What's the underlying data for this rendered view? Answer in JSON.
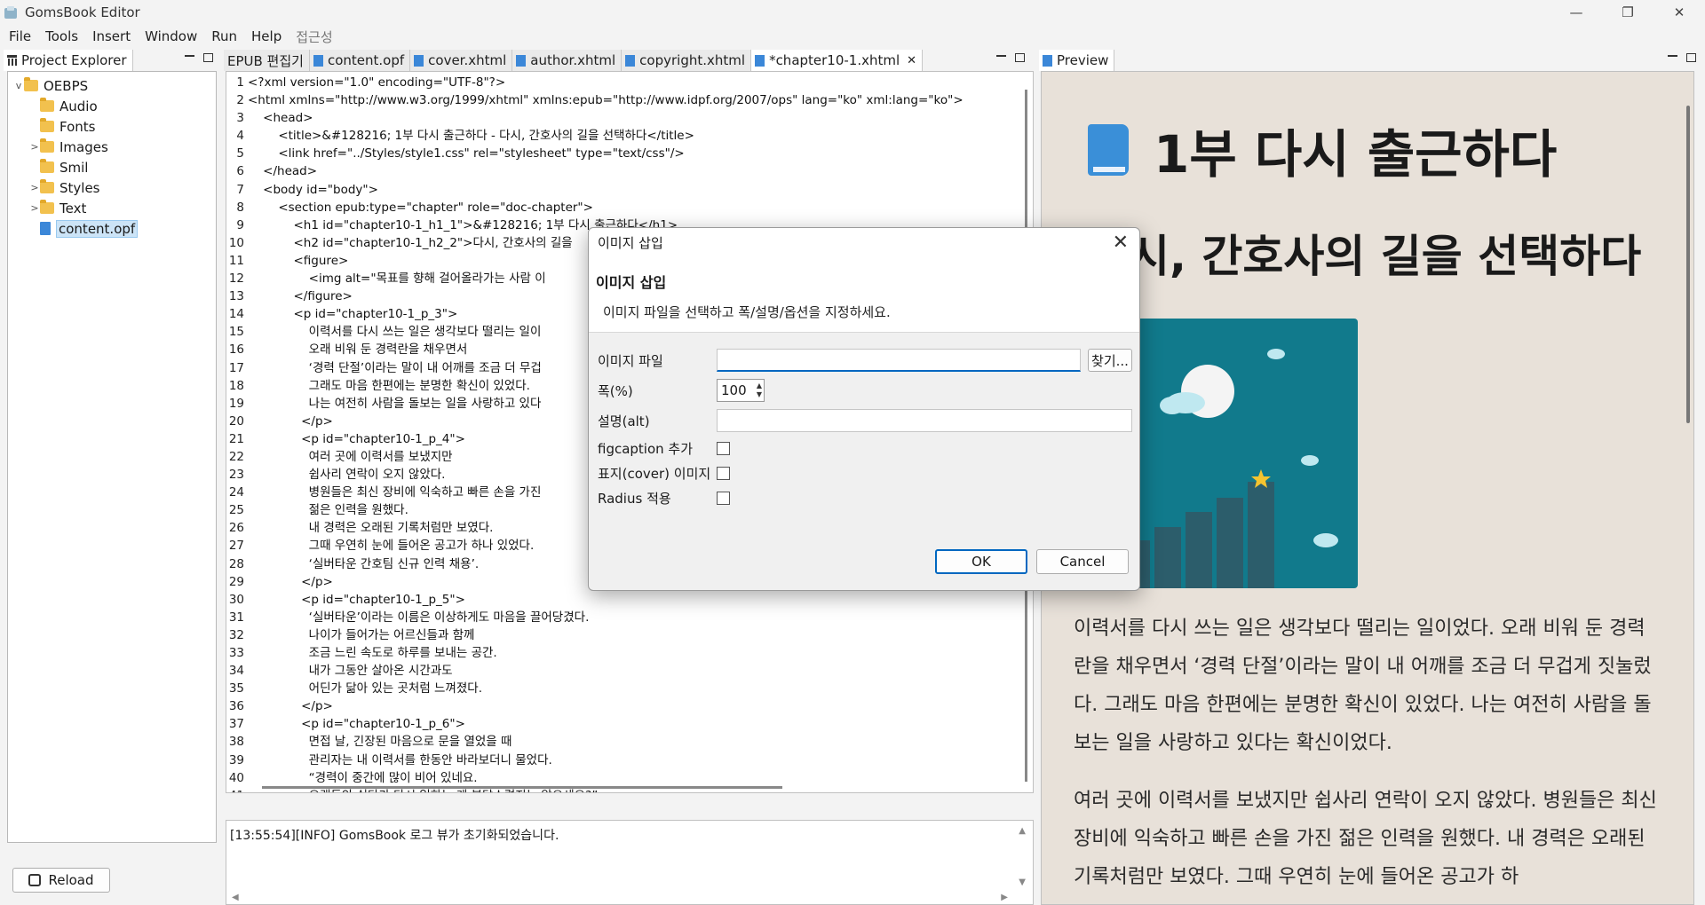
{
  "window": {
    "title": "GomsBook Editor",
    "controls": {
      "minimize": "—",
      "maximize": "❐",
      "close": "✕"
    }
  },
  "menu": [
    "File",
    "Tools",
    "Insert",
    "Window",
    "Run",
    "Help",
    "접근성"
  ],
  "project_explorer": {
    "tab_label": "Project Explorer",
    "tree": [
      {
        "label": "OEBPS",
        "type": "folder",
        "expander": "v",
        "depth": 0
      },
      {
        "label": "Audio",
        "type": "folder",
        "expander": "",
        "depth": 1
      },
      {
        "label": "Fonts",
        "type": "folder",
        "expander": "",
        "depth": 1
      },
      {
        "label": "Images",
        "type": "folder",
        "expander": ">",
        "depth": 1
      },
      {
        "label": "Smil",
        "type": "folder",
        "expander": "",
        "depth": 1
      },
      {
        "label": "Styles",
        "type": "folder",
        "expander": ">",
        "depth": 1
      },
      {
        "label": "Text",
        "type": "folder",
        "expander": ">",
        "depth": 1
      },
      {
        "label": "content.opf",
        "type": "file",
        "expander": "",
        "depth": 1,
        "selected": true
      }
    ],
    "reload_label": "Reload"
  },
  "editor": {
    "tabs": [
      {
        "label": "EPUB 편집기",
        "icon": false
      },
      {
        "label": "content.opf",
        "icon": true
      },
      {
        "label": "cover.xhtml",
        "icon": true
      },
      {
        "label": "author.xhtml",
        "icon": true
      },
      {
        "label": "copyright.xhtml",
        "icon": true
      },
      {
        "label": "*chapter10-1.xhtml",
        "icon": true,
        "active": true,
        "close": "✕"
      }
    ],
    "lines": [
      "<?xml version=\"1.0\" encoding=\"UTF-8\"?>",
      "<html xmlns=\"http://www.w3.org/1999/xhtml\" xmlns:epub=\"http://www.idpf.org/2007/ops\" lang=\"ko\" xml:lang=\"ko\">",
      "    <head>",
      "        <title>&#128216; 1부 다시 출근하다 - 다시, 간호사의 길을 선택하다</title>",
      "        <link href=\"../Styles/style1.css\" rel=\"stylesheet\" type=\"text/css\"/>",
      "    </head>",
      "    <body id=\"body\">",
      "        <section epub:type=\"chapter\" role=\"doc-chapter\">",
      "            <h1 id=\"chapter10-1_h1_1\">&#128216; 1부 다시 출근하다</h1>",
      "            <h2 id=\"chapter10-1_h2_2\">다시, 간호사의 길을",
      "            <figure>",
      "                <img alt=\"목표를 향해 걸어올라가는 사람 이",
      "            </figure>",
      "            <p id=\"chapter10-1_p_3\">",
      "                이력서를 다시 쓰는 일은 생각보다 떨리는 일이",
      "                오래 비워 둔 경력란을 채우면서",
      "                ‘경력 단절’이라는 말이 내 어깨를 조금 더 무겁",
      "                그래도 마음 한편에는 분명한 확신이 있었다.",
      "                나는 여전히 사람을 돌보는 일을 사랑하고 있다",
      "              </p>",
      "              <p id=\"chapter10-1_p_4\">",
      "                여러 곳에 이력서를 보냈지만",
      "                쉽사리 연락이 오지 않았다.",
      "                병원들은 최신 장비에 익숙하고 빠른 손을 가진",
      "                젊은 인력을 원했다.",
      "                내 경력은 오래된 기록처럼만 보였다.",
      "                그때 우연히 눈에 들어온 공고가 하나 있었다.",
      "                ‘실버타운 간호팀 신규 인력 채용’.",
      "              </p>",
      "              <p id=\"chapter10-1_p_5\">",
      "                ‘실버타운’이라는 이름은 이상하게도 마음을 끌어당겼다.",
      "                나이가 들어가는 어르신들과 함께",
      "                조금 느린 속도로 하루를 보내는 공간.",
      "                내가 그동안 살아온 시간과도",
      "                어딘가 닮아 있는 곳처럼 느껴졌다.",
      "              </p>",
      "              <p id=\"chapter10-1_p_6\">",
      "                면접 날, 긴장된 마음으로 문을 열었을 때",
      "                관리자는 내 이력서를 한동안 바라보더니 물었다.",
      "                “경력이 중간에 많이 비어 있네요.",
      "                오랫동안 쉬다가 다시 일하는 게 부담스럽지는 않으세요?”"
    ],
    "log": "[13:55:54][INFO] GomsBook 로그 뷰가 초기화되었습니다."
  },
  "preview": {
    "tab_label": "Preview",
    "h1": "1부 다시 출근하다",
    "h2": "다시, 간호사의 길을 선택하다",
    "paragraphs": [
      "이력서를 다시 쓰는 일은 생각보다 떨리는 일이었다. 오래 비워 둔 경력란을 채우면서 ‘경력 단절’이라는 말이 내 어깨를 조금 더 무겁게 짓눌렀다. 그래도 마음 한편에는 분명한 확신이 있었다. 나는 여전히 사람을 돌보는 일을 사랑하고 있다는 확신이었다.",
      "여러 곳에 이력서를 보냈지만 쉽사리 연락이 오지 않았다. 병원들은 최신 장비에 익숙하고 빠른 손을 가진 젊은 인력을 원했다. 내 경력은 오래된 기록처럼만 보였다. 그때 우연히 눈에 들어온 공고가 하"
    ]
  },
  "dialog": {
    "title": "이미지 삽입",
    "heading": "이미지 삽입",
    "description": "이미지 파일을 선택하고 폭/설명/옵션을 지정하세요.",
    "fields": {
      "image_file_label": "이미지 파일",
      "image_file_value": "",
      "browse_label": "찾기...",
      "width_label": "폭(%)",
      "width_value": "100",
      "alt_label": "설명(alt)",
      "alt_value": "",
      "figcaption_label": "figcaption 추가",
      "cover_label": "표지(cover) 이미지",
      "radius_label": "Radius 적용"
    },
    "ok_label": "OK",
    "cancel_label": "Cancel",
    "close_glyph": "✕"
  },
  "colors": {
    "accent": "#0067c0",
    "preview_bg": "#e8e1d9",
    "image_bg": "#117a8c",
    "folder": "#f2c14e",
    "file_icon": "#3b87d8"
  }
}
